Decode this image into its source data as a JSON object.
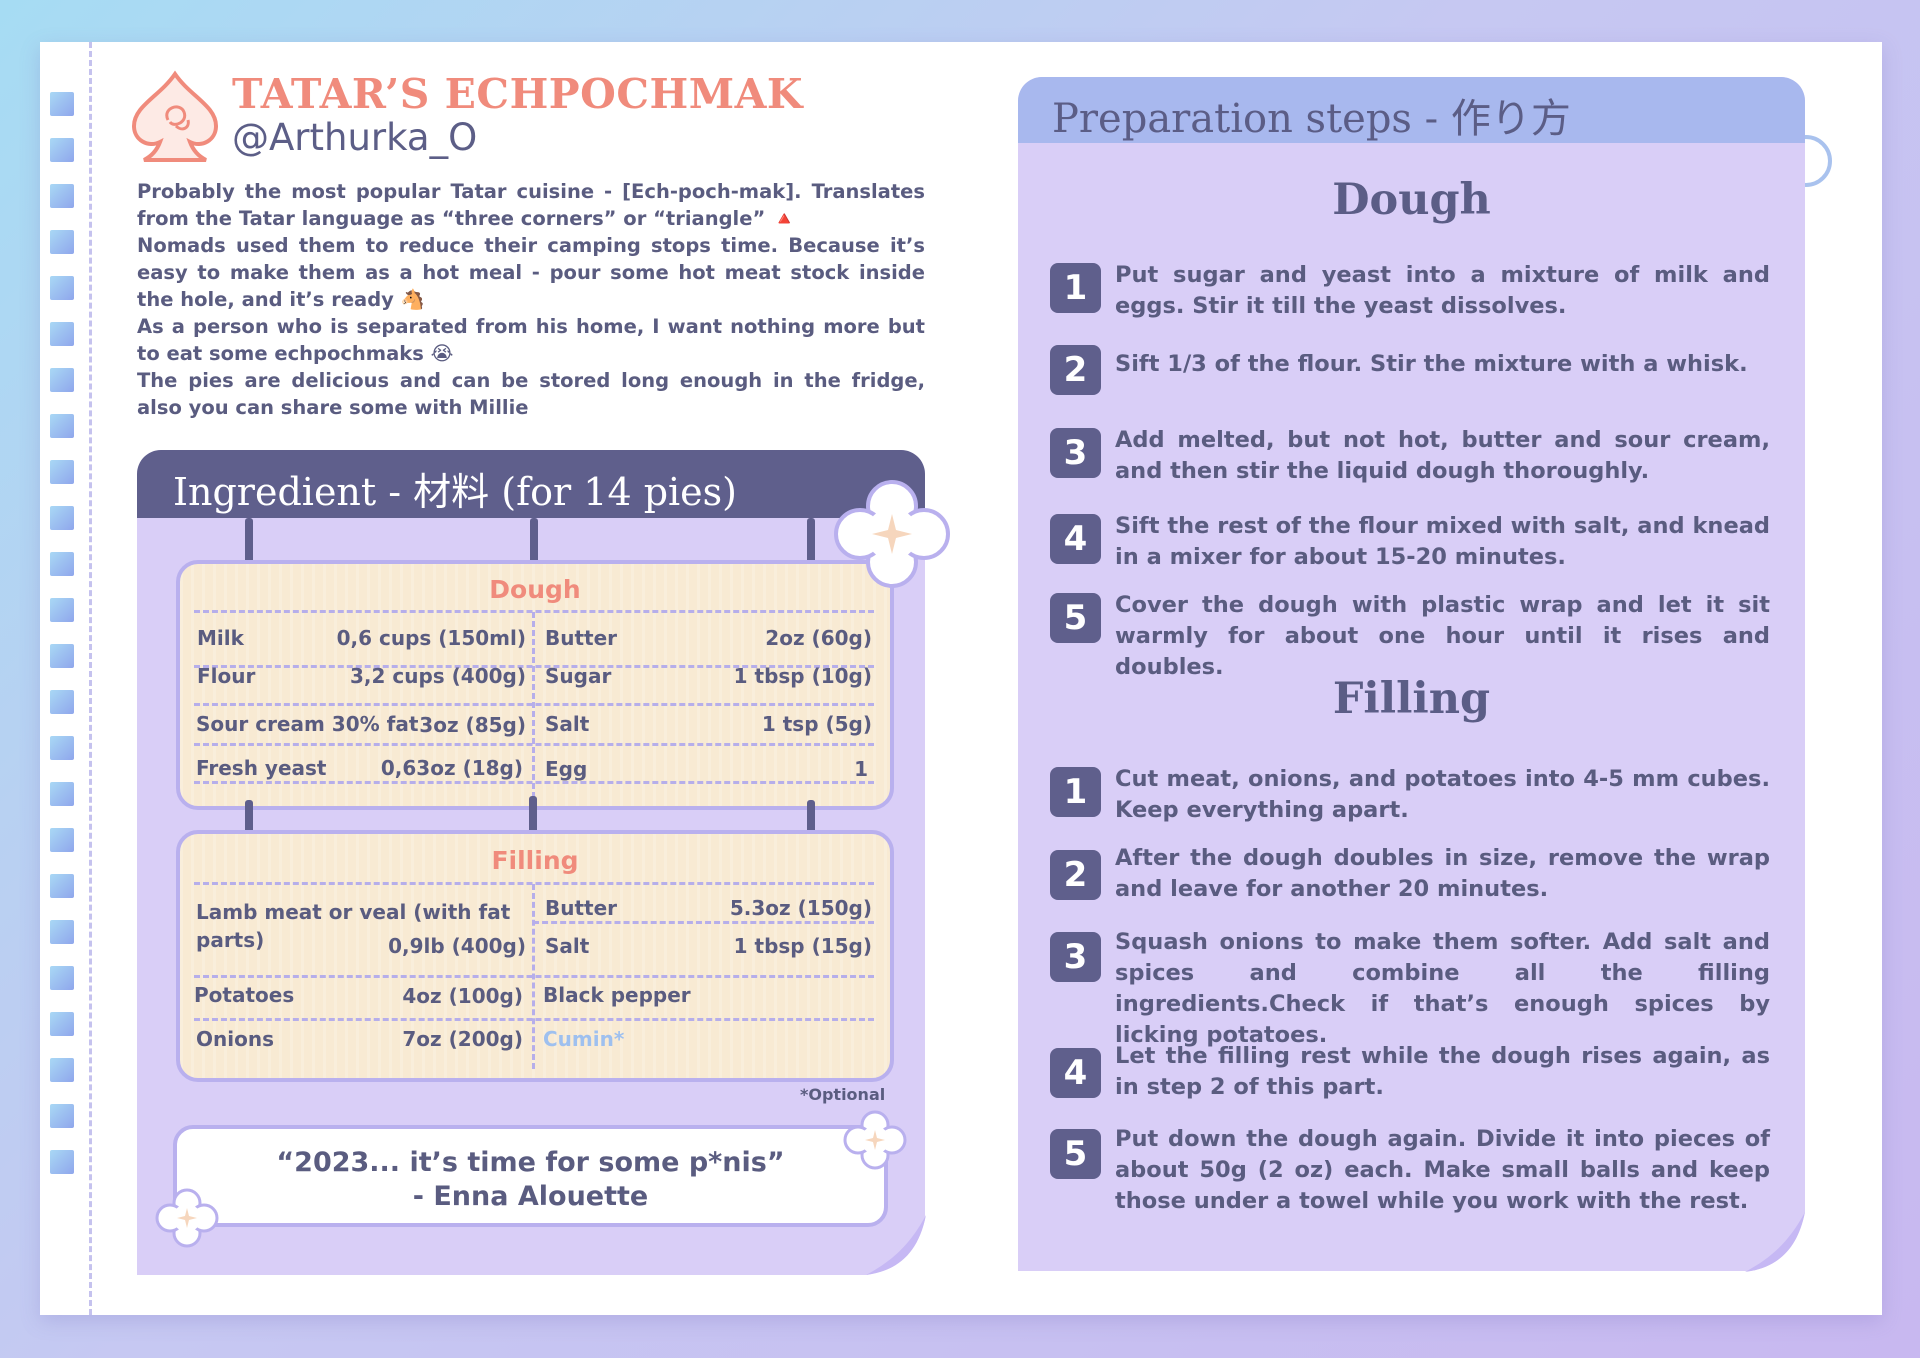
{
  "header": {
    "title": "TATAR’S ECHPOCHMAK",
    "handle": "@Arthurka_O"
  },
  "intro": {
    "p1": "Probably the most popular Tatar cuisine - [Ech-poch-mak]. Translates from the Tatar language as “three corners” or “triangle” 🔺",
    "p2": "Nomads used them to reduce their camping stops time. Because it’s easy to make them as a hot meal - pour some hot meat stock inside the hole, and it’s ready 🐴",
    "p3": "As a person who is separated from his home, I want nothing more but to eat some echpochmaks 😭",
    "p4": "The pies are delicious and can be stored long enough in the fridge, also you can share some with Millie"
  },
  "ingredients": {
    "heading": "Ingredient - 材料 (for 14 pies)",
    "dough": {
      "title": "Dough",
      "rows": [
        {
          "name_l": "Milk",
          "qty_l": "0,6 cups (150ml)",
          "name_r": "Butter",
          "qty_r": "2oz (60g)"
        },
        {
          "name_l": "Flour",
          "qty_l": "3,2 cups (400g)",
          "name_r": "Sugar",
          "qty_r": "1 tbsp (10g)"
        },
        {
          "name_l": "Sour cream 30% fat",
          "qty_l": "3oz (85g)",
          "name_r": "Salt",
          "qty_r": "1 tsp (5g)"
        },
        {
          "name_l": "Fresh yeast",
          "qty_l": "0,63oz (18g)",
          "name_r": "Egg",
          "qty_r": "1"
        }
      ]
    },
    "filling": {
      "title": "Filling",
      "meat_line1": "Lamb meat or veal (with fat",
      "meat_line2": "parts)",
      "meat_qty": "0,9lb (400g)",
      "butter": "Butter",
      "butter_qty": "5.3oz (150g)",
      "salt": "Salt",
      "salt_qty": "1 tbsp (15g)",
      "potatoes": "Potatoes",
      "potatoes_qty": "4oz (100g)",
      "pepper": "Black pepper",
      "onions": "Onions",
      "onions_qty": "7oz (200g)",
      "cumin": "Cumin*"
    },
    "optional_note": "*Optional"
  },
  "quote": {
    "line1": "“2023... it’s time for some p*nis”",
    "line2": "- Enna Alouette"
  },
  "steps": {
    "heading": "Preparation steps - 作り方",
    "dough_title": "Dough",
    "dough_steps": [
      {
        "num": "1",
        "text": "Put sugar and yeast into a mixture of milk and eggs. Stir it till the yeast dissolves."
      },
      {
        "num": "2",
        "text": "Sift 1/3 of the flour. Stir the mixture with a whisk."
      },
      {
        "num": "3",
        "text": "Add melted, but not hot, butter and sour cream, and then stir the liquid dough thoroughly."
      },
      {
        "num": "4",
        "text": "Sift the rest of the flour mixed with salt, and knead in a mixer for about 15-20 minutes."
      },
      {
        "num": "5",
        "text": "Cover the dough with plastic wrap and let it sit warmly for about one hour until it rises and doubles."
      }
    ],
    "filling_title": "Filling",
    "filling_steps": [
      {
        "num": "1",
        "text": "Cut meat, onions, and potatoes into 4-5 mm cubes. Keep everything apart."
      },
      {
        "num": "2",
        "text": "After the dough doubles in size, remove the wrap and leave for another 20 minutes."
      },
      {
        "num": "3",
        "text": "Squash onions to make them softer. Add salt and spices and combine all the filling ingredients.Check if that’s enough spices by licking potatoes."
      },
      {
        "num": "4",
        "text": "Let the filling rest while the dough rises again, as in step 2 of this part."
      },
      {
        "num": "5",
        "text": "Put down the dough again. Divide it into pieces of about 50g (2 oz) each. Make small balls and keep those under a towel while you work with the rest."
      }
    ]
  },
  "colors": {
    "accent_title": "#f08b7c",
    "dark_header": "#5f5f8c",
    "panel": "#d9cef7",
    "steps_header": "#a8b8ee",
    "card": "#f8ead3",
    "cumin": "#9ec0ef"
  },
  "icons": [
    "spade-logo-icon",
    "flower-icon"
  ]
}
